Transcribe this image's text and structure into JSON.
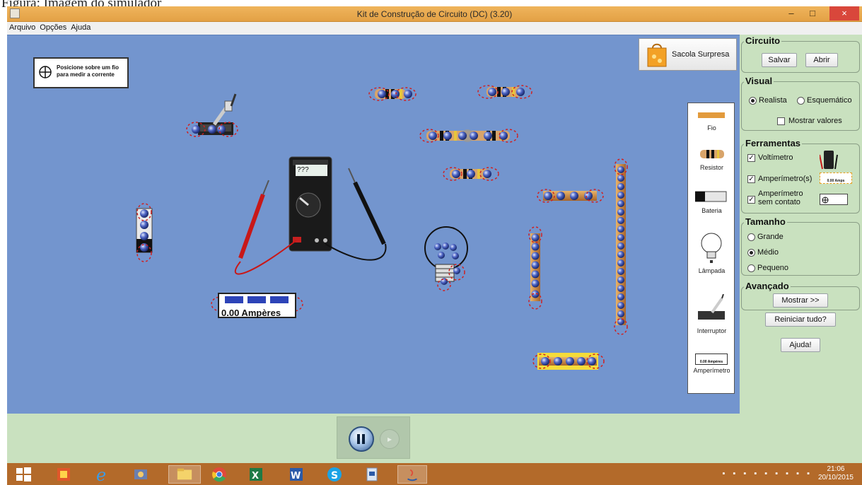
{
  "caption": "Figura: Imagem do simulador",
  "window": {
    "title": "Kit de Construção de Circuito (DC) (3.20)",
    "minimize": "–",
    "maximize": "□",
    "close": "×"
  },
  "menu": [
    "Arquivo",
    "Opções",
    "Ajuda"
  ],
  "canvas": {
    "probe_hint": [
      "Posicione sobre um fio",
      "para medir a corrente"
    ],
    "sacola": "Sacola Surpresa",
    "voltmeter_display": "???",
    "ammeter_reading": "0.00 Ampères"
  },
  "toolbox": {
    "items": [
      "Fio",
      "Resistor",
      "Bateria",
      "Lâmpada",
      "Interruptor",
      "Amperímetro"
    ],
    "ammeter_icon_text": "0.00 Ampères"
  },
  "panel": {
    "circuito": {
      "title": "Circuito",
      "save": "Salvar",
      "open": "Abrir"
    },
    "visual": {
      "title": "Visual",
      "realista": "Realista",
      "esquematico": "Esquemático",
      "mostrar_valores": "Mostrar valores",
      "selected": "Realista",
      "mostrar_valores_checked": false
    },
    "ferramentas": {
      "title": "Ferramentas",
      "voltimetro": "Voltímetro",
      "amperimetro": "Amperímetro(s)",
      "amperimetro_icon": "0.00 Amps",
      "sem_contato_1": "Amperímetro",
      "sem_contato_2": "sem contato",
      "voltimetro_checked": true,
      "amperimetro_checked": true,
      "sem_contato_checked": true
    },
    "tamanho": {
      "title": "Tamanho",
      "grande": "Grande",
      "medio": "Médio",
      "pequeno": "Pequeno",
      "selected": "Médio"
    },
    "avancado": {
      "title": "Avançado",
      "mostrar": "Mostrar >>"
    },
    "reiniciar": "Reiniciar tudo?",
    "ajuda": "Ajuda!"
  },
  "taskbar": {
    "time": "21:06",
    "date": "20/10/2015",
    "apps": [
      "start-icon",
      "paint-icon",
      "internet-explorer-icon",
      "media-icon",
      "file-explorer-icon",
      "chrome-icon",
      "excel-icon",
      "word-icon",
      "skype-icon",
      "document-icon",
      "java-icon"
    ]
  },
  "colors": {
    "canvas": "#7395ce",
    "panel": "#c9e1bf",
    "titlebar": "#e7a84f",
    "taskbar": "#b36a2a"
  }
}
